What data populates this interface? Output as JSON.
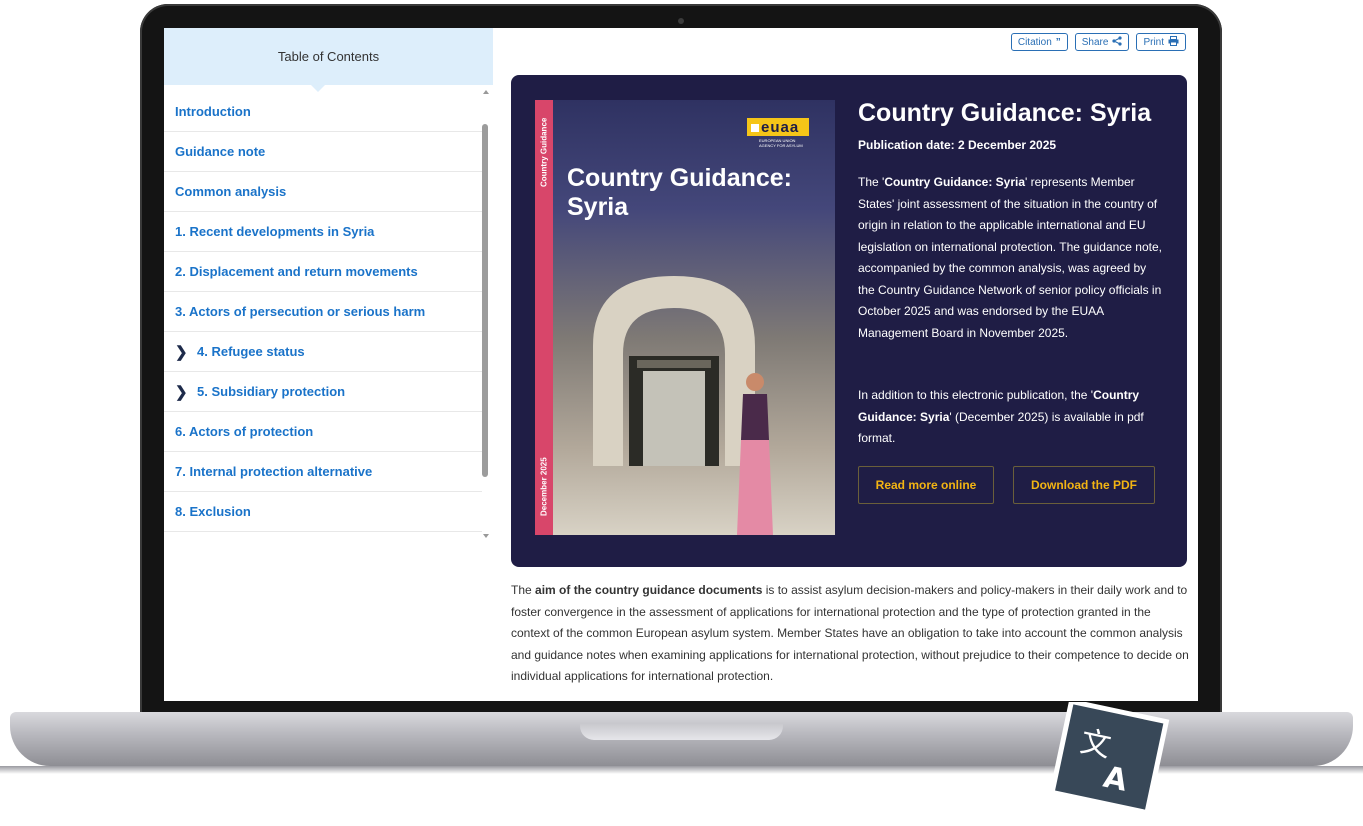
{
  "toc": {
    "heading": "Table of Contents",
    "items": [
      {
        "label": "Introduction",
        "expandable": false
      },
      {
        "label": "Guidance note",
        "expandable": false
      },
      {
        "label": "Common analysis",
        "expandable": false
      },
      {
        "label": "1. Recent developments in Syria",
        "expandable": false
      },
      {
        "label": "2. Displacement and return movements",
        "expandable": false
      },
      {
        "label": "3. Actors of persecution or serious harm",
        "expandable": false
      },
      {
        "label": "4. Refugee status",
        "expandable": true
      },
      {
        "label": "5. Subsidiary protection",
        "expandable": true
      },
      {
        "label": "6. Actors of protection",
        "expandable": false
      },
      {
        "label": "7. Internal protection alternative",
        "expandable": false
      },
      {
        "label": "8. Exclusion",
        "expandable": false
      }
    ]
  },
  "toolbar": {
    "citation": "Citation",
    "share": "Share",
    "print": "Print"
  },
  "cover": {
    "strip_top": "Country Guidance",
    "strip_bottom": "December 2025",
    "logo": "euaa",
    "logo_sub_1": "EUROPEAN UNION",
    "logo_sub_2": "AGENCY FOR ASYLUM",
    "title_line1": "Country Guidance:",
    "title_line2": "Syria"
  },
  "hero": {
    "title": "Country Guidance: Syria",
    "pub_date": "Publication date: 2 December 2025",
    "p1_a": "The '",
    "p1_bold": "Country Guidance: Syria",
    "p1_b": "' represents Member States' joint assessment of the situation in the country of origin in relation to the applicable international and EU legislation on international protection. The guidance note, accompanied by the common analysis, was agreed by the Country Guidance Network of senior policy officials in October 2025 and was endorsed by the EUAA Management Board in November 2025.",
    "p2_a": "In addition to this electronic publication, the '",
    "p2_bold": "Country Guidance: Syria",
    "p2_b": "' (December 2025) is available in pdf format.",
    "read_more": "Read more online",
    "download": "Download the PDF"
  },
  "body": {
    "a": "The ",
    "bold": "aim of the country guidance documents",
    "b": " is to assist asylum decision-makers and policy-makers in their daily work and to foster convergence in the assessment of applications for international protection and the type of protection granted in the context of the common European asylum system. Member States have an obligation to take into account the common analysis and guidance notes when examining applications for international protection, without prejudice to their competence to decide on individual applications for international protection."
  },
  "colors": {
    "hero_bg": "#1f1d45",
    "link_blue": "#1a73c9",
    "accent_yellow": "#f2b413",
    "cover_strip": "#d8466a",
    "toc_header_bg": "#ddeefb"
  },
  "icons": [
    "quote-icon",
    "share-icon",
    "print-icon",
    "chevron-right-icon",
    "translate-icon"
  ]
}
